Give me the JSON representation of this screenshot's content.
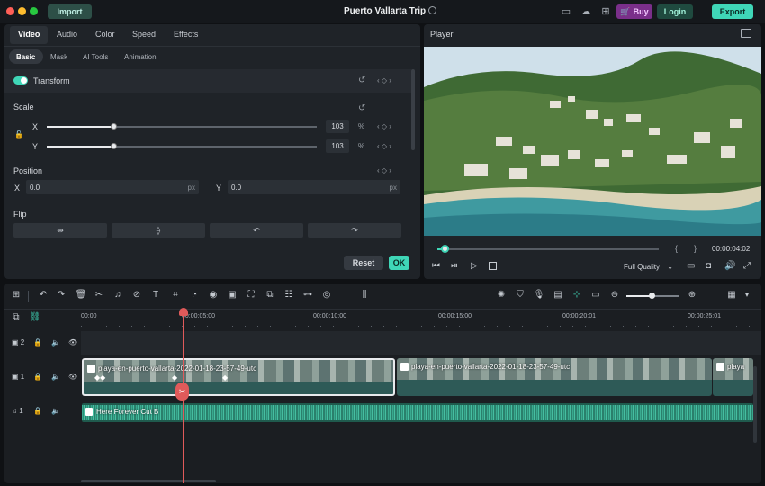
{
  "titlebar": {
    "import_label": "Import",
    "project_title": "Puerto Vallarta Trip",
    "buy_label": "Buy",
    "login_label": "Login",
    "export_label": "Export"
  },
  "props": {
    "tabs": [
      "Video",
      "Audio",
      "Color",
      "Speed",
      "Effects"
    ],
    "subtabs": [
      "Basic",
      "Mask",
      "AI Tools",
      "Animation"
    ],
    "transform_label": "Transform",
    "scale_label": "Scale",
    "x_label": "X",
    "y_label": "Y",
    "scale_x_value": "103",
    "scale_y_value": "103",
    "percent_unit": "%",
    "scale_x_fraction": 0.25,
    "scale_y_fraction": 0.25,
    "position_label": "Position",
    "pos_x_label": "X",
    "pos_x_value": "0.0",
    "pos_y_label": "Y",
    "pos_y_value": "0.0",
    "px_unit": "px",
    "flip_label": "Flip",
    "reset_label": "Reset",
    "ok_label": "OK"
  },
  "player": {
    "title": "Player",
    "open_bracket": "{",
    "close_bracket": "}",
    "timecode": "00:00:04:02",
    "quality_label": "Full Quality"
  },
  "timeline": {
    "ruler": [
      "00:00",
      "00:00:05:00",
      "00:00:10:00",
      "00:00:15:00",
      "00:00:20:01",
      "00:00:25:01"
    ],
    "track_video2_num": "2",
    "track_video1_num": "1",
    "track_audio1_num": "1",
    "clip1_name": "playa-en-puerto-vallarta-2022-01-18-23-57-49-utc",
    "clip2_name": "playa-en-puerto-vallarta-2022-01-18-23-57-49-utc",
    "clip3_name": "playa",
    "audio_name": "Here Forever Cut B"
  },
  "colors": {
    "accent": "#3fd6b7",
    "buy_bg": "#7a2f8a",
    "login_bg": "#1f4a3f",
    "export_bg": "#3fd6b7",
    "playhead": "#e05a5a",
    "audio_wave": "#3aa98f"
  }
}
